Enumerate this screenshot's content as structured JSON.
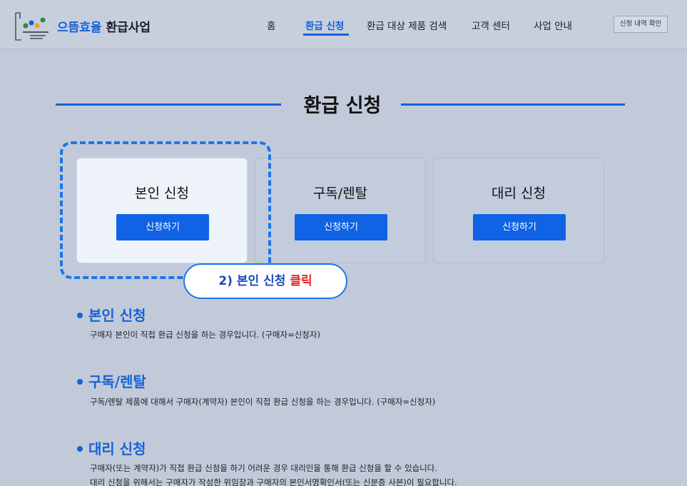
{
  "header": {
    "brand_accent": "으뜸효율",
    "brand_rest": "환급사업",
    "logo_icon": "leaf-logo-icon",
    "nav": [
      {
        "label": "홈"
      },
      {
        "label": "환급 신청",
        "active": true
      },
      {
        "label": "환급 대상 제품 검색"
      },
      {
        "label": "고객 센터"
      },
      {
        "label": "사업 안내"
      }
    ],
    "history_button": "신청 내역 확인"
  },
  "main": {
    "title": "환급 신청",
    "cards": [
      {
        "title": "본인 신청",
        "button": "신청하기",
        "selected": true
      },
      {
        "title": "구독/렌탈",
        "button": "신청하기",
        "selected": false
      },
      {
        "title": "대리 신청",
        "button": "신청하기",
        "selected": false
      }
    ],
    "callout": {
      "text": "2) 본인 신청 ",
      "emphasis": "클릭"
    },
    "descriptions": [
      {
        "heading": "본인 신청",
        "lines": [
          "구매자 본인이 직접 환급 신청을 하는 경우입니다. (구매자=신청자)"
        ]
      },
      {
        "heading": "구독/렌탈",
        "lines": [
          "구독/렌탈 제품에 대해서 구매자(계약자) 본인이 직접 환급 신청을 하는 경우입니다. (구매자=신청자)"
        ]
      },
      {
        "heading": "대리 신청",
        "lines": [
          "구매자(또는 계약자)가 직접 환급 신청을 하기 어려운 경우 대리인을 통해 환급 신청을 할 수 있습니다.",
          "대리 신청을 위해서는 구매자가 작성한 위임장과 구매자의 본인서명확인서(또는 신분증 사본)이 필요합니다."
        ]
      }
    ]
  },
  "colors": {
    "accent": "#1562d6",
    "button": "#0f63e4",
    "callout_red": "#e5201f",
    "background": "#c2cad9"
  }
}
